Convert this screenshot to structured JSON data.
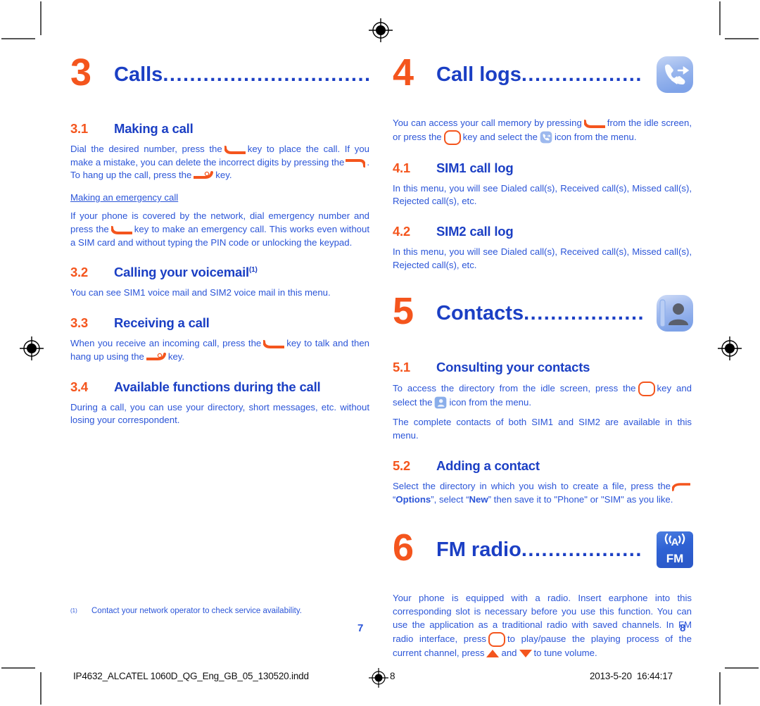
{
  "document": {
    "colors": {
      "orange": "#F4551D",
      "blue_heading": "#1B3FC4",
      "blue_body": "#2B55D8"
    },
    "left_page_number": "7",
    "right_page_number": "8",
    "footnote_mark": "(1)",
    "footnote_text": "Contact your network operator to check service availability."
  },
  "footer": {
    "filename": "IP4632_ALCATEL 1060D_QG_Eng_GB_05_130520.indd",
    "page_marker": "8",
    "date": "2013-5-20",
    "time": "16:44:17"
  },
  "left_column": {
    "chapter": {
      "number": "3",
      "title": "Calls",
      "dots": "...............................................",
      "icon": ""
    },
    "sections": [
      {
        "number": "3.1",
        "title": "Making a call",
        "superscript": "",
        "paragraphs": [
          "Dial the desired number, press the [KEY_SEND] key to place the call. If you make a mistake, you can delete the incorrect digits by pressing the [KEY_DEL] . To hang up the call, press the [KEY_END] key."
        ],
        "subhead": "Making an emergency call",
        "subhead_paragraphs": [
          "If your phone is covered by the network, dial emergency number and press the [KEY_SEND] key to make an emergency call. This works even without a SIM card and without typing the PIN code or unlocking the keypad."
        ]
      },
      {
        "number": "3.2",
        "title": "Calling your voicemail",
        "superscript": "(1)",
        "paragraphs": [
          "You can see SIM1 voice mail and SIM2 voice mail in this menu."
        ]
      },
      {
        "number": "3.3",
        "title": "Receiving a call",
        "superscript": "",
        "paragraphs": [
          "When you receive an incoming call, press the [KEY_SEND] key to talk and then hang up using the [KEY_END] key."
        ]
      },
      {
        "number": "3.4",
        "title": "Available functions during the call",
        "superscript": "",
        "paragraphs": [
          "During a call, you can use your directory, short messages, etc. without losing your correspondent."
        ]
      }
    ]
  },
  "right_column": {
    "chapters": [
      {
        "number": "4",
        "title": "Call logs",
        "dots": "..................",
        "icon": "call-logs-icon",
        "intro": "You can access your call memory by pressing [KEY_SEND] from the idle screen, or press the [KEY_OK] key and select the [ICON_CALLLOG] icon from the menu.",
        "sections": [
          {
            "number": "4.1",
            "title": "SIM1 call log",
            "paragraphs": [
              "In this menu, you will see Dialed call(s), Received call(s), Missed call(s), Rejected call(s), etc."
            ]
          },
          {
            "number": "4.2",
            "title": "SIM2 call log",
            "paragraphs": [
              "In this menu, you will see Dialed call(s), Received call(s), Missed call(s), Rejected call(s), etc."
            ]
          }
        ]
      },
      {
        "number": "5",
        "title": "Contacts",
        "dots": "..................",
        "icon": "contacts-icon",
        "intro": "",
        "sections": [
          {
            "number": "5.1",
            "title": "Consulting your contacts",
            "paragraphs": [
              "To access the directory from the idle screen, press the [KEY_OK] key and select the [ICON_CONTACTS] icon from the menu.",
              "The complete contacts of both SIM1 and SIM2 are available in this menu."
            ]
          },
          {
            "number": "5.2",
            "title": "Adding a contact",
            "paragraphs": [
              "Select the directory in which you wish to create a file, press the [KEY_SOFT] \"Options\", select \"New\" then save it to \"Phone\" or \"SIM\" as you like."
            ]
          }
        ]
      },
      {
        "number": "6",
        "title": "FM radio",
        "dots": "..................",
        "icon": "fm-radio-icon",
        "intro": "Your phone is equipped with a radio. Insert earphone into this corresponding slot is necessary before you use this function. You can use the application as a traditional radio with saved channels. In FM radio interface, press [KEY_OK] to play/pause the playing process of the current channel, press [KEY_UP] and [KEY_DOWN] to tune volume.",
        "sections": []
      }
    ]
  }
}
